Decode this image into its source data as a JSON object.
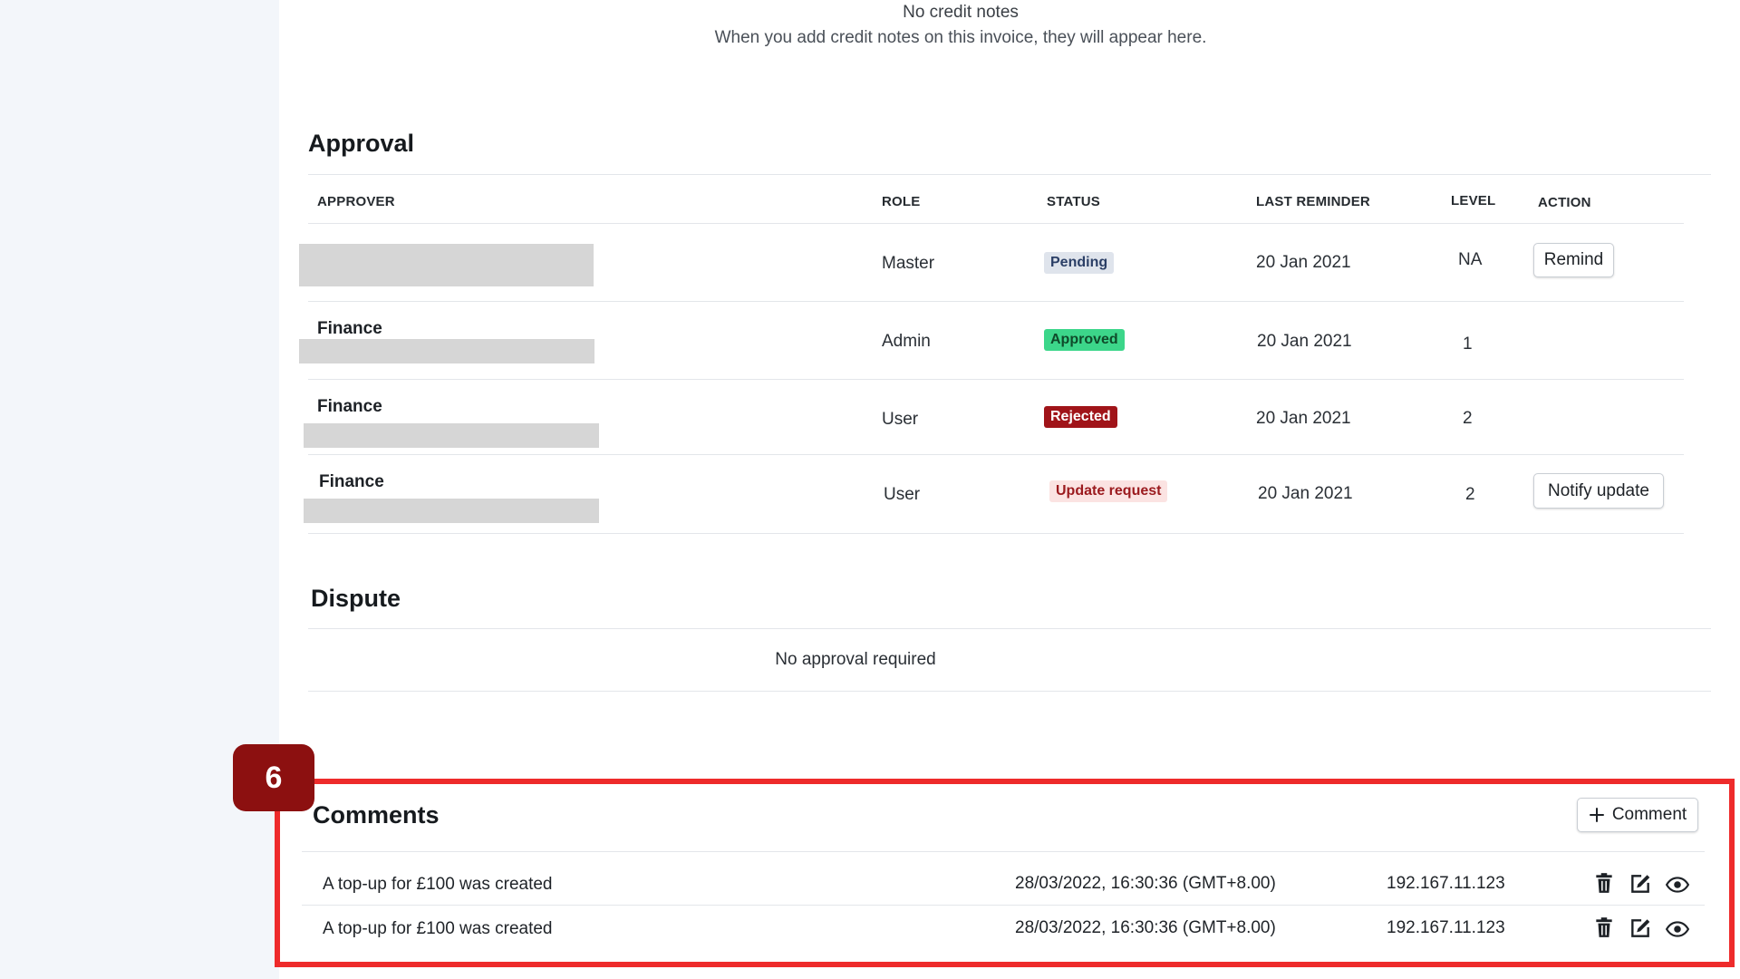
{
  "credit_notes": {
    "empty_title": "No credit notes",
    "empty_message": "When you add credit notes on this invoice, they will appear here."
  },
  "approval": {
    "title": "Approval",
    "columns": [
      "APPROVER",
      "ROLE",
      "STATUS",
      "LAST REMINDER",
      "LEVEL",
      "ACTION"
    ],
    "rows": [
      {
        "approver": "",
        "role": "Master",
        "status": "Pending",
        "status_kind": "pending",
        "last_reminder": "20 Jan 2021",
        "level": "NA",
        "action": "Remind"
      },
      {
        "approver": "Finance",
        "role": "Admin",
        "status": "Approved",
        "status_kind": "approved",
        "last_reminder": "20 Jan 2021",
        "level": "1",
        "action": ""
      },
      {
        "approver": "Finance",
        "role": "User",
        "status": "Rejected",
        "status_kind": "rejected",
        "last_reminder": "20 Jan 2021",
        "level": "2",
        "action": ""
      },
      {
        "approver": "Finance",
        "role": "User",
        "status": "Update request",
        "status_kind": "update",
        "last_reminder": "20 Jan 2021",
        "level": "2",
        "action": "Notify update"
      }
    ]
  },
  "dispute": {
    "title": "Dispute",
    "empty_message": "No approval required"
  },
  "step_badge": "6",
  "comments": {
    "title": "Comments",
    "add_button_label": "Comment",
    "rows": [
      {
        "text": "A top-up for £100 was created",
        "timestamp": "28/03/2022, 16:30:36 (GMT+8.00)",
        "ip": "192.167.11.123"
      },
      {
        "text": "A top-up for £100 was created",
        "timestamp": "28/03/2022, 16:30:36 (GMT+8.00)",
        "ip": "192.167.11.123"
      }
    ]
  },
  "icons": {
    "delete": "trash-icon",
    "edit": "edit-icon",
    "view": "eye-icon",
    "add": "plus-icon"
  },
  "colors": {
    "highlight_border": "#ee2b2b",
    "step_badge": "#8c1010",
    "approved": "#3cd68a",
    "rejected": "#a01419",
    "pending": "#dfe4ec",
    "update_request": "#fbe3e2"
  }
}
